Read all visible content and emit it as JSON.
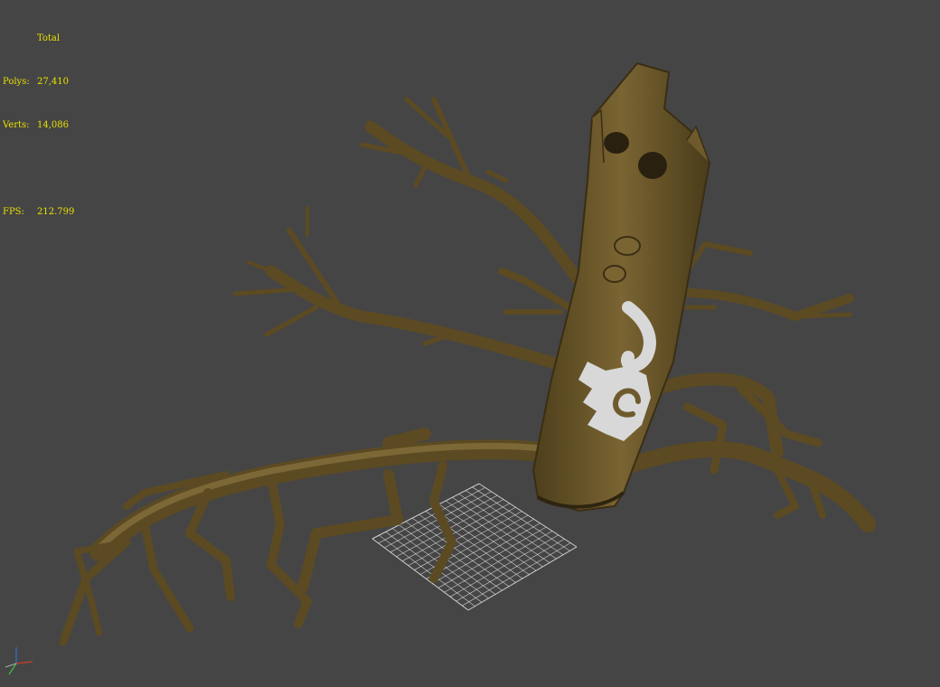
{
  "viewport": {
    "background": "#454545",
    "stats": {
      "header": "Total",
      "polys_label": "Polys:",
      "polys_value": "27,410",
      "verts_label": "Verts:",
      "verts_value": "14,086",
      "fps_label": "FPS:",
      "fps_value": "212.799",
      "text_color": "#e8e000"
    },
    "model": {
      "subject": "dead-tree",
      "bark_color": "#6e5a2c",
      "bark_dark": "#3a2e14",
      "emblem_color": "#d8d8d8"
    },
    "grid": {
      "color": "#e6e6e6"
    },
    "axis_gizmo": {
      "x_color": "#d23a2a",
      "y_color": "#3ac23a",
      "z_color": "#3a6ad2"
    }
  }
}
